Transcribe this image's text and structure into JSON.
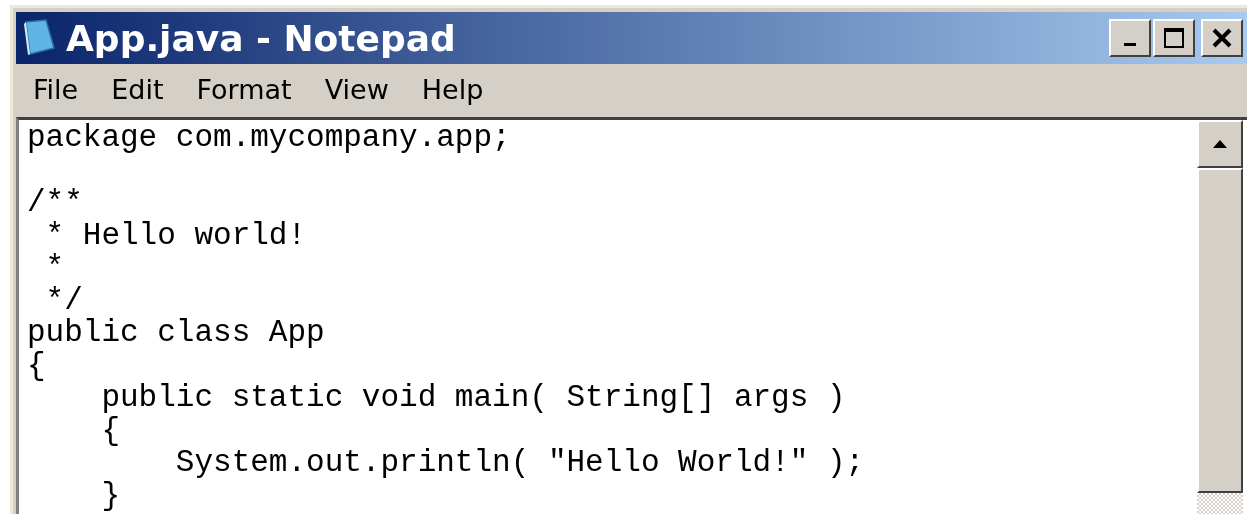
{
  "window": {
    "title": "App.java - Notepad"
  },
  "menu": [
    "File",
    "Edit",
    "Format",
    "View",
    "Help"
  ],
  "editor": {
    "paragraphs": [
      [
        "package com.mycompany.app;"
      ],
      [
        "/**",
        " * Hello world!",
        " *",
        " */",
        "public class App",
        "{",
        "    public static void main( String[] args )",
        "    {",
        "        System.out.println( \"Hello World!\" );",
        "    }"
      ]
    ]
  }
}
